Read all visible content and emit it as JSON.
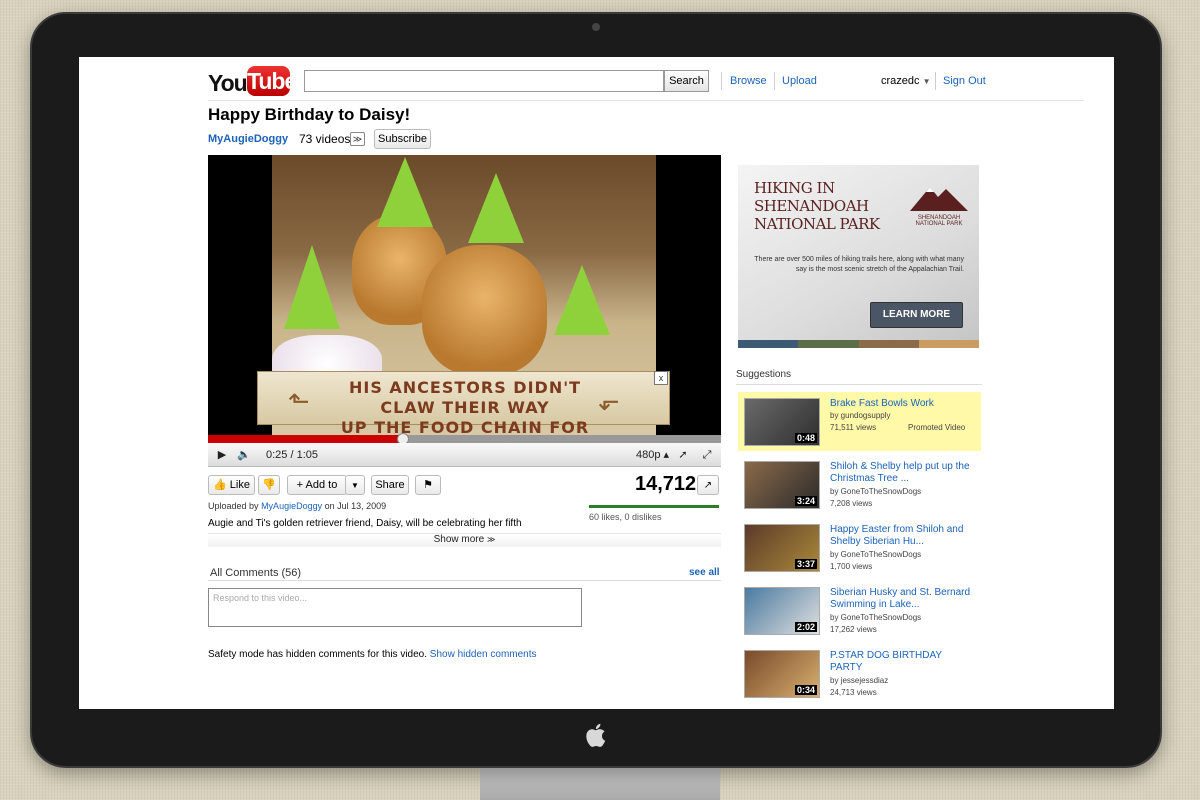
{
  "header": {
    "logo_you": "You",
    "logo_tube": "Tube",
    "search_button": "Search",
    "browse": "Browse",
    "upload": "Upload",
    "username": "crazedc",
    "sign_out": "Sign Out"
  },
  "video": {
    "title": "Happy Birthday to Daisy!",
    "channel": "MyAugieDoggy",
    "channel_videos": "73 videos",
    "subscribe": "Subscribe",
    "overlay_ad_line1": "HIS ANCESTORS DIDN'T CLAW THEIR WAY",
    "overlay_ad_line2": "UP THE FOOD CHAIN FOR THIS.",
    "overlay_close": "x",
    "time": "0:25 / 1:05",
    "quality": "480p",
    "progress_fraction": 0.38,
    "like": "Like",
    "add_to": "Add to",
    "share": "Share",
    "views": "14,712",
    "likes_text": "60 likes, 0 dislikes",
    "uploaded_prefix": "Uploaded by",
    "uploaded_user": "MyAugieDoggy",
    "uploaded_date": "on Jul 13, 2009",
    "description": "Augie and Ti's golden retriever friend, Daisy, will be celebrating her fifth",
    "show_more": "Show more"
  },
  "comments": {
    "heading": "All Comments (56)",
    "see_all": "see all",
    "placeholder": "Respond to this video...",
    "safety_text": "Safety mode has hidden comments for this video.",
    "show_hidden": "Show hidden comments"
  },
  "ad": {
    "title": "HIKING IN SHENANDOAH NATIONAL PARK",
    "logo": "SHENANDOAH NATIONAL PARK",
    "body": "There are over 500 miles of hiking trails here, along with what many say is the most scenic stretch of the Appalachian Trail.",
    "button": "LEARN MORE",
    "stripe_colors": [
      "#3d5a75",
      "#5b6e47",
      "#8c6b4a",
      "#c99d62"
    ]
  },
  "suggestions": {
    "heading": "Suggestions",
    "items": [
      {
        "title": "Brake Fast Bowls Work",
        "by": "by gundogsupply",
        "views": "71,511 views",
        "duration": "0:48",
        "promoted": "Promoted Video"
      },
      {
        "title": "Shiloh & Shelby help put up the Christmas Tree ...",
        "by": "by GoneToTheSnowDogs",
        "views": "7,208 views",
        "duration": "3:24",
        "promoted": ""
      },
      {
        "title": "Happy Easter from Shiloh and Shelby Siberian Hu...",
        "by": "by GoneToTheSnowDogs",
        "views": "1,700 views",
        "duration": "3:37",
        "promoted": ""
      },
      {
        "title": "Siberian Husky and St. Bernard Swimming in Lake...",
        "by": "by GoneToTheSnowDogs",
        "views": "17,262 views",
        "duration": "2:02",
        "promoted": ""
      },
      {
        "title": "P.STAR DOG BIRTHDAY PARTY",
        "by": "by jessejessdiaz",
        "views": "24,713 views",
        "duration": "0:34",
        "promoted": ""
      }
    ]
  },
  "colors": {
    "link": "#1c62b9",
    "promoted_bg": "#fff9a8",
    "brand_red": "#cc0000"
  }
}
